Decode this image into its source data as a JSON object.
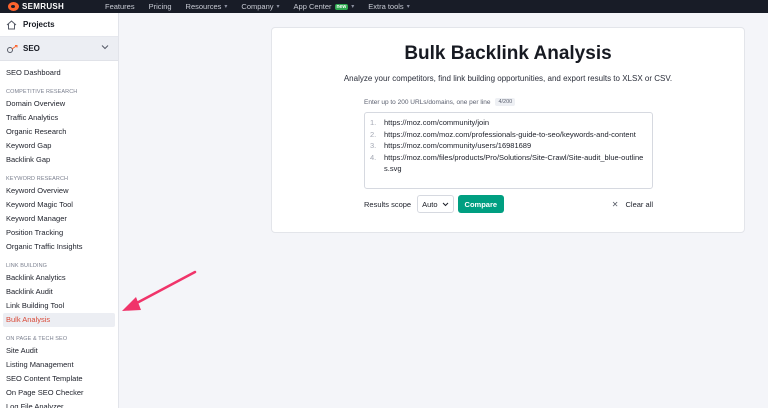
{
  "topbar": {
    "logo": "SEMRUSH",
    "nav": [
      {
        "label": "Features",
        "caret": false,
        "badge": ""
      },
      {
        "label": "Pricing",
        "caret": false,
        "badge": ""
      },
      {
        "label": "Resources",
        "caret": true,
        "badge": ""
      },
      {
        "label": "Company",
        "caret": true,
        "badge": ""
      },
      {
        "label": "App Center",
        "caret": true,
        "badge": "new"
      },
      {
        "label": "Extra tools",
        "caret": true,
        "badge": ""
      }
    ]
  },
  "sidebar": {
    "projects": "Projects",
    "seo": "SEO",
    "entries": [
      {
        "type": "item",
        "label": "SEO Dashboard"
      },
      {
        "type": "section",
        "label": "COMPETITIVE RESEARCH"
      },
      {
        "type": "item",
        "label": "Domain Overview"
      },
      {
        "type": "item",
        "label": "Traffic Analytics"
      },
      {
        "type": "item",
        "label": "Organic Research"
      },
      {
        "type": "item",
        "label": "Keyword Gap"
      },
      {
        "type": "item",
        "label": "Backlink Gap"
      },
      {
        "type": "section",
        "label": "KEYWORD RESEARCH"
      },
      {
        "type": "item",
        "label": "Keyword Overview"
      },
      {
        "type": "item",
        "label": "Keyword Magic Tool"
      },
      {
        "type": "item",
        "label": "Keyword Manager"
      },
      {
        "type": "item",
        "label": "Position Tracking"
      },
      {
        "type": "item",
        "label": "Organic Traffic Insights"
      },
      {
        "type": "section",
        "label": "LINK BUILDING"
      },
      {
        "type": "item",
        "label": "Backlink Analytics"
      },
      {
        "type": "item",
        "label": "Backlink Audit"
      },
      {
        "type": "item",
        "label": "Link Building Tool"
      },
      {
        "type": "item",
        "label": "Bulk Analysis",
        "active": true
      },
      {
        "type": "section",
        "label": "ON PAGE & TECH SEO"
      },
      {
        "type": "item",
        "label": "Site Audit"
      },
      {
        "type": "item",
        "label": "Listing Management"
      },
      {
        "type": "item",
        "label": "SEO Content Template"
      },
      {
        "type": "item",
        "label": "On Page SEO Checker"
      },
      {
        "type": "item",
        "label": "Log File Analyzer"
      }
    ]
  },
  "main": {
    "title": "Bulk Backlink Analysis",
    "subtitle": "Analyze your competitors, find link building opportunities, and export results to XLSX or CSV.",
    "hint": "Enter up to 200 URLs/domains, one per line",
    "counter": "4/200",
    "urls": [
      {
        "num": "1.",
        "text": "https://moz.com/community/join"
      },
      {
        "num": "2.",
        "text": "https://moz.com/moz.com/professionals-guide-to-seo/keywords-and-content"
      },
      {
        "num": "3.",
        "text": "https://moz.com/community/users/16981689"
      },
      {
        "num": "4.",
        "text": "https://moz.com/files/products/Pro/Solutions/Site-Crawl/Site-audit_blue-outlines.svg"
      }
    ],
    "scope_label": "Results scope",
    "scope_value": "Auto",
    "compare_label": "Compare",
    "clear_label": "Clear all"
  },
  "colors": {
    "accent": "#009f81",
    "active_item": "#d94a38",
    "annotation_arrow": "#f0346a",
    "topbar": "#181c27"
  }
}
